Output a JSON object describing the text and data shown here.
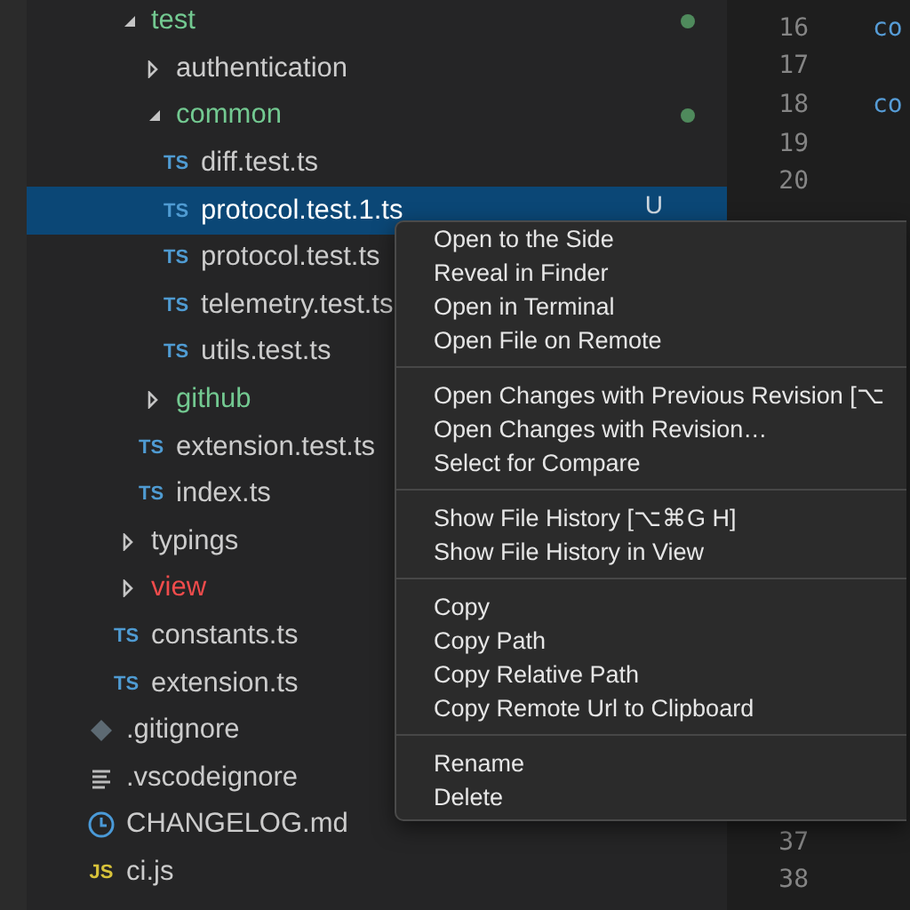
{
  "explorer": {
    "items": [
      {
        "children": [
          {
            "kind": "folder",
            "label": "test",
            "expanded": true,
            "color": "#73c991",
            "dot": true,
            "selected": false,
            "children": [
              {
                "kind": "folder",
                "label": "authentication",
                "expanded": false,
                "color": "#cccccc",
                "dot": false,
                "selected": false
              },
              {
                "kind": "folder",
                "label": "common",
                "expanded": true,
                "color": "#73c991",
                "dot": true,
                "selected": false,
                "children": [
                  {
                    "kind": "ts",
                    "icon_label": "TS",
                    "label": "diff.test.ts",
                    "color": "#cccccc",
                    "dot": false,
                    "selected": false
                  },
                  {
                    "kind": "ts",
                    "icon_label": "TS",
                    "label": "protocol.test.1.ts",
                    "color": "#ffffff",
                    "dot": false,
                    "selected": true,
                    "badge": "U"
                  },
                  {
                    "kind": "ts",
                    "icon_label": "TS",
                    "label": "protocol.test.ts",
                    "color": "#cccccc",
                    "selected": false
                  },
                  {
                    "kind": "ts",
                    "icon_label": "TS",
                    "label": "telemetry.test.ts",
                    "color": "#cccccc",
                    "selected": false
                  },
                  {
                    "kind": "ts",
                    "icon_label": "TS",
                    "label": "utils.test.ts",
                    "color": "#cccccc",
                    "selected": false
                  }
                ]
              },
              {
                "kind": "folder",
                "label": "github",
                "expanded": false,
                "color": "#73c991",
                "selected": false
              },
              {
                "kind": "ts",
                "icon_label": "TS",
                "label": "extension.test.ts",
                "color": "#cccccc",
                "selected": false
              },
              {
                "kind": "ts",
                "icon_label": "TS",
                "label": "index.ts",
                "color": "#cccccc",
                "selected": false
              }
            ]
          },
          {
            "kind": "folder",
            "label": "typings",
            "expanded": false,
            "color": "#cccccc",
            "selected": false
          },
          {
            "kind": "folder",
            "label": "view",
            "expanded": false,
            "color": "#f14c4c",
            "selected": false
          },
          {
            "kind": "ts",
            "icon_label": "TS",
            "label": "constants.ts",
            "color": "#cccccc",
            "selected": false
          },
          {
            "kind": "ts",
            "icon_label": "TS",
            "label": "extension.ts",
            "color": "#cccccc",
            "selected": false
          }
        ]
      },
      {
        "kind": "git",
        "label": ".gitignore",
        "color": "#cccccc",
        "selected": false
      },
      {
        "kind": "lines",
        "label": ".vscodeignore",
        "color": "#cccccc",
        "selected": false
      },
      {
        "kind": "clock",
        "label": "CHANGELOG.md",
        "color": "#cccccc",
        "selected": false
      },
      {
        "kind": "js",
        "icon_label": "JS",
        "label": "ci.js",
        "color": "#cccccc",
        "selected": false
      }
    ]
  },
  "editor": {
    "top_lines": [
      {
        "number": "16",
        "code": "co"
      },
      {
        "number": "17"
      },
      {
        "number": "18",
        "code": "co"
      },
      {
        "number": "19"
      },
      {
        "number": "20"
      }
    ],
    "bottom_lines": [
      {
        "number": "37"
      },
      {
        "number": "38"
      }
    ]
  },
  "context_menu": {
    "groups": [
      [
        "Open to the Side",
        "Reveal in Finder",
        "Open in Terminal",
        "Open File on Remote"
      ],
      [
        "Open Changes with Previous Revision [⌥",
        "Open Changes with Revision…",
        "Select for Compare"
      ],
      [
        "Show File History [⌥⌘G H]",
        "Show File History in View"
      ],
      [
        "Copy",
        "Copy Path",
        "Copy Relative Path",
        "Copy Remote Url to Clipboard"
      ],
      [
        "Rename",
        "Delete"
      ]
    ]
  }
}
